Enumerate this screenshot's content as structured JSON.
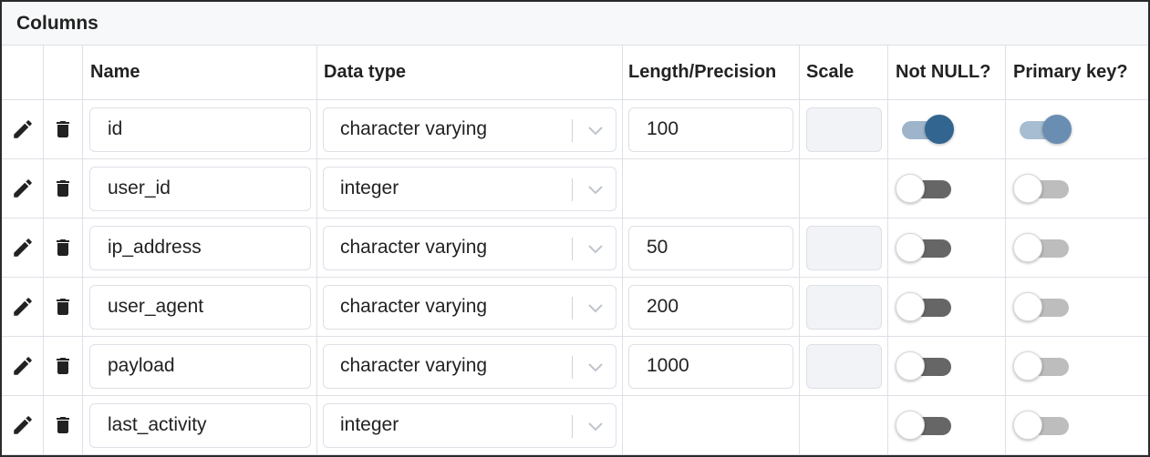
{
  "panel": {
    "title": "Columns"
  },
  "headers": {
    "name": "Name",
    "data_type": "Data type",
    "length": "Length/Precision",
    "scale": "Scale",
    "not_null": "Not NULL?",
    "primary_key": "Primary key?"
  },
  "icons": {
    "edit": "pencil-icon",
    "delete": "trash-icon",
    "dropdown": "chevron-down-icon"
  },
  "colors": {
    "toggle_on": "#326690",
    "toggle_off_track": "#666666",
    "border": "#dde0e6"
  },
  "rows": [
    {
      "name": "id",
      "data_type": "character varying",
      "length": "100",
      "has_length": true,
      "not_null": true,
      "primary_key": true
    },
    {
      "name": "user_id",
      "data_type": "integer",
      "length": "",
      "has_length": false,
      "not_null": false,
      "primary_key": false
    },
    {
      "name": "ip_address",
      "data_type": "character varying",
      "length": "50",
      "has_length": true,
      "not_null": false,
      "primary_key": false
    },
    {
      "name": "user_agent",
      "data_type": "character varying",
      "length": "200",
      "has_length": true,
      "not_null": false,
      "primary_key": false
    },
    {
      "name": "payload",
      "data_type": "character varying",
      "length": "1000",
      "has_length": true,
      "not_null": false,
      "primary_key": false
    },
    {
      "name": "last_activity",
      "data_type": "integer",
      "length": "",
      "has_length": false,
      "not_null": false,
      "primary_key": false
    }
  ]
}
